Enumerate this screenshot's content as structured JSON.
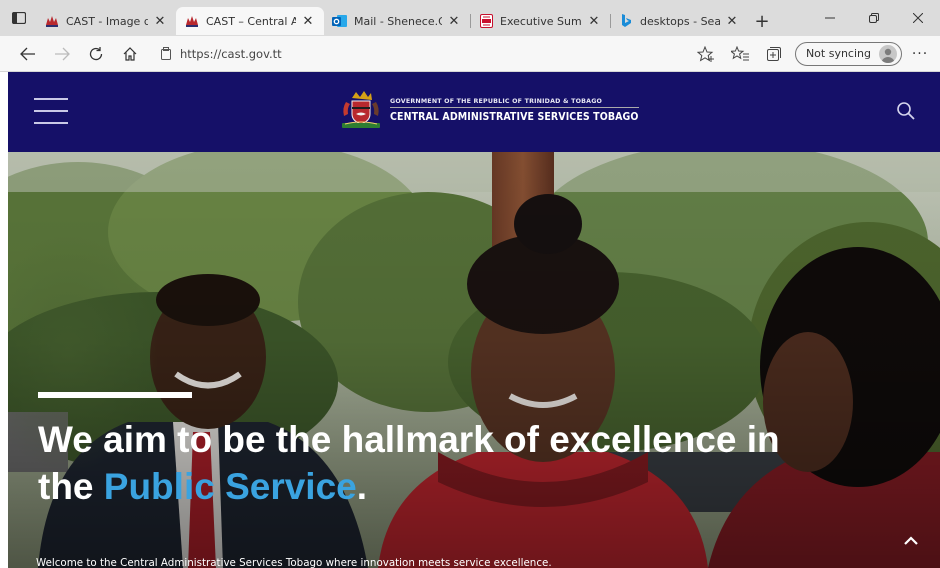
{
  "browser": {
    "tabs": [
      {
        "title": "CAST - Image details",
        "favicon": "cast-crest-icon",
        "active": false
      },
      {
        "title": "CAST – Central Admi",
        "favicon": "cast-crest-icon",
        "active": true
      },
      {
        "title": "Mail - Shenece.Gord",
        "favicon": "outlook-icon",
        "active": false
      },
      {
        "title": "Executive Summary_",
        "favicon": "pdf-icon",
        "active": false
      },
      {
        "title": "desktops - Search",
        "favicon": "bing-icon",
        "active": false
      }
    ],
    "address": {
      "url": "https://cast.gov.tt"
    },
    "sync_label": "Not syncing",
    "more_label": "···",
    "colors": {
      "tabstrip": "#dcdcdc",
      "toolbar": "#f7f7f7"
    }
  },
  "site": {
    "header": {
      "gov_line": "GOVERNMENT OF THE REPUBLIC OF TRINIDAD & TOBAGO",
      "name": "CENTRAL ADMINISTRATIVE SERVICES TOBAGO",
      "background": "#151068"
    },
    "hero": {
      "headline_part1": "We aim to be the hallmark of excellence in the ",
      "headline_accent": "Public Service",
      "headline_end": ".",
      "subtext": "Welcome to the Central Administrative Services Tobago where innovation meets service excellence.",
      "accent_color": "#3aa3e0"
    }
  }
}
